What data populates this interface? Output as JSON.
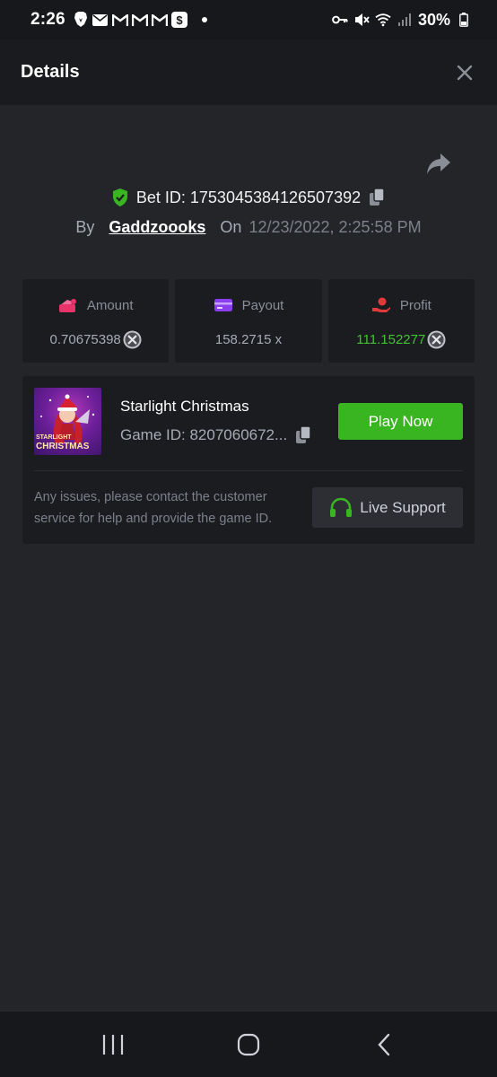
{
  "status_bar": {
    "time": "2:26",
    "battery": "30%",
    "left_icons": [
      "brave-icon",
      "mail-icon",
      "gmail-icon",
      "gmail-icon",
      "gmail-icon",
      "cashapp-icon"
    ],
    "right_icons": [
      "key-icon",
      "mute-icon",
      "wifi-icon",
      "signal-icon",
      "battery-icon"
    ]
  },
  "header": {
    "title": "Details"
  },
  "bet": {
    "bet_id": "Bet ID: 1753045384126507392",
    "by_label": "By",
    "username": "Gaddzoooks",
    "on_label": "On",
    "date": "12/23/2022, 2:25:58 PM"
  },
  "stats": [
    {
      "label": "Amount",
      "value": "0.70675398",
      "icon": "wallet-icon",
      "color": "#e8336b"
    },
    {
      "label": "Payout",
      "value": "158.2715 x",
      "icon": "card-icon",
      "color": "#8b3ef0"
    },
    {
      "label": "Profit",
      "value": "111.152277",
      "icon": "hand-coin-icon",
      "color": "#e03a3a"
    }
  ],
  "game": {
    "thumb_line1": "STARLIGHT",
    "thumb_line2": "CHRISTMAS",
    "name": "Starlight Christmas",
    "game_id": "Game ID: 8207060672...",
    "play_label": "Play Now",
    "help_text": "Any issues, please contact the customer service for help and provide the game ID.",
    "support_label": "Live Support"
  },
  "colors": {
    "accent_green": "#3ab522",
    "profit_green": "#3fc62f",
    "background": "#232529",
    "card": "#1b1c1f"
  }
}
